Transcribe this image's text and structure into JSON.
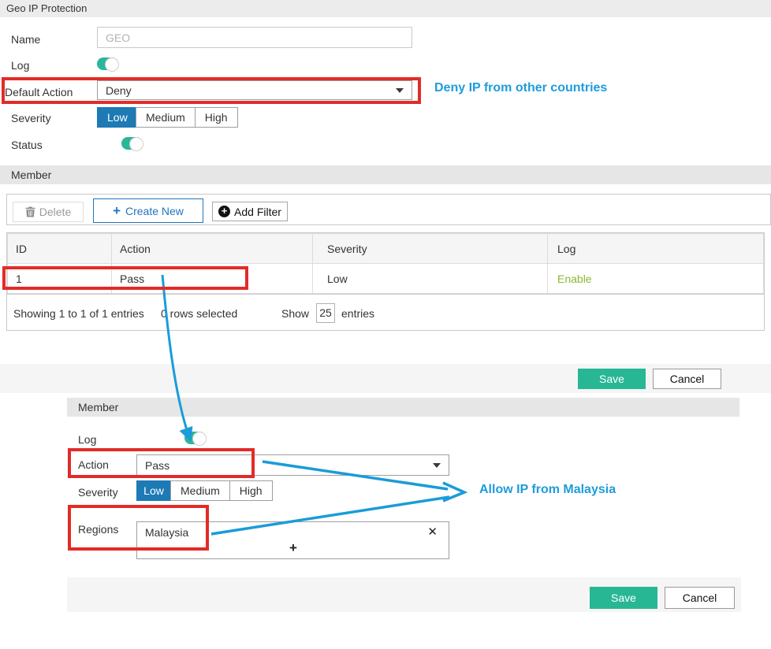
{
  "title_bar": {
    "title": "Geo IP Protection"
  },
  "form": {
    "name_label": "Name",
    "name_placeholder": "GEO",
    "log_label": "Log",
    "default_action_label": "Default Action",
    "default_action_value": "Deny",
    "severity_label": "Severity",
    "severity_options": [
      "Low",
      "Medium",
      "High"
    ],
    "severity_selected": "Low",
    "status_label": "Status"
  },
  "annotations": {
    "deny_note": "Deny IP from other countries",
    "allow_note": "Allow IP from Malaysia"
  },
  "member_list": {
    "title": "Member",
    "toolbar": {
      "delete_label": "Delete",
      "create_new_icon": "+",
      "create_new_label": "Create New",
      "add_filter_icon": "+",
      "add_filter_label": "Add Filter"
    },
    "table": {
      "columns": [
        "ID",
        "Action",
        "Severity",
        "Log"
      ],
      "row": {
        "id": "1",
        "action": "Pass",
        "severity": "Low",
        "log": "Enable"
      }
    },
    "pagination": {
      "showing_text": "Showing 1 to 1 of 1 entries",
      "selected_text": "0 rows selected",
      "show_label": "Show",
      "page_size": "25",
      "entries_label": "entries"
    },
    "save_label": "Save",
    "cancel_label": "Cancel"
  },
  "member_editor": {
    "title": "Member",
    "log_label": "Log",
    "action_label": "Action",
    "action_value": "Pass",
    "severity_label": "Severity",
    "severity_options": [
      "Low",
      "Medium",
      "High"
    ],
    "severity_selected": "Low",
    "regions_label": "Regions",
    "regions_value": "Malaysia",
    "remove_symbol": "✕",
    "add_symbol": "+",
    "save_label": "Save",
    "cancel_label": "Cancel"
  },
  "colors": {
    "accent_teal": "#27b795",
    "selected_blue": "#1d7ab5",
    "create_new_blue": "#2176bd",
    "annotation_blue": "#1e9cdc",
    "highlight_red": "#e22b28",
    "enable_green": "#8ab933",
    "bar_gray": "#e6e6e6"
  }
}
